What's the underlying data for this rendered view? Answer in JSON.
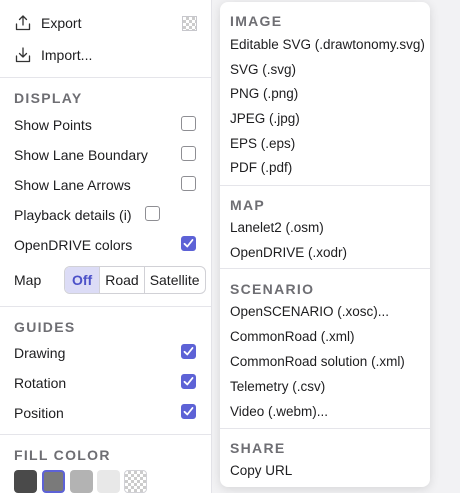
{
  "file": {
    "export_label": "Export",
    "import_label": "Import..."
  },
  "display": {
    "header": "DISPLAY",
    "items": [
      {
        "label": "Show Points",
        "checked": false
      },
      {
        "label": "Show Lane Boundary",
        "checked": false
      },
      {
        "label": "Show Lane Arrows",
        "checked": false
      },
      {
        "label": "Playback details (i)",
        "checked": false
      },
      {
        "label": "OpenDRIVE colors",
        "checked": true
      }
    ],
    "map_label": "Map",
    "map_options": [
      "Off",
      "Road",
      "Satellite"
    ],
    "map_selected": "Off"
  },
  "guides": {
    "header": "GUIDES",
    "items": [
      {
        "label": "Drawing",
        "checked": true
      },
      {
        "label": "Rotation",
        "checked": true
      },
      {
        "label": "Position",
        "checked": true
      }
    ]
  },
  "fill_color": {
    "header": "FILL COLOR",
    "swatches": [
      "#4a4a4a",
      "#7a7a7a",
      "#b3b3b3",
      "#e8e8e8",
      "transparent"
    ],
    "selected_index": 1
  },
  "menu": {
    "image": {
      "header": "IMAGE",
      "items": [
        "Editable SVG (.drawtonomy.svg)",
        "SVG (.svg)",
        "PNG (.png)",
        "JPEG (.jpg)",
        "EPS (.eps)",
        "PDF (.pdf)"
      ]
    },
    "map": {
      "header": "MAP",
      "items": [
        "Lanelet2 (.osm)",
        "OpenDRIVE (.xodr)"
      ]
    },
    "scenario": {
      "header": "SCENARIO",
      "items": [
        "OpenSCENARIO (.xosc)...",
        "CommonRoad (.xml)",
        "CommonRoad solution (.xml)",
        "Telemetry (.csv)",
        "Video (.webm)..."
      ]
    },
    "share": {
      "header": "SHARE",
      "items": [
        "Copy URL"
      ]
    }
  },
  "colors": {
    "accent": "#5d62d6",
    "segment_selected_bg": "#dcdcf6",
    "header_text": "#6e6e73"
  }
}
